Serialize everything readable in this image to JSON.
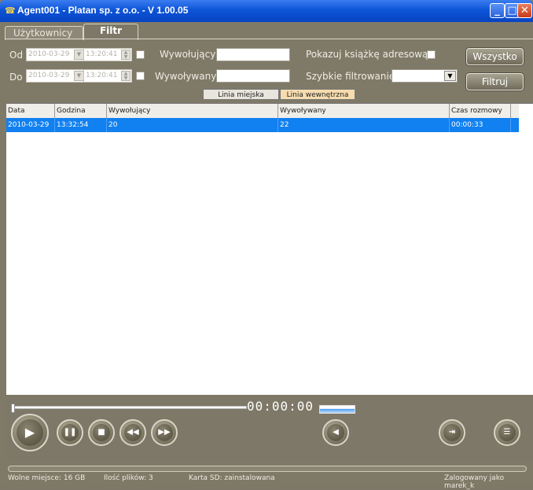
{
  "window": {
    "title": "Agent001 - Platan sp. z o.o. - V 1.00.05",
    "controls": {
      "minimize": "_",
      "maximize": "□",
      "close": "✕"
    }
  },
  "tabs": [
    {
      "label": "Użytkownicy",
      "active": false
    },
    {
      "label": "Filtr",
      "active": true
    }
  ],
  "filter": {
    "from_label": "Od",
    "to_label": "Do",
    "from_date": "2010-03-29",
    "from_time": "13:20:41",
    "to_date": "2010-03-29",
    "to_time": "13:20:41",
    "caller_label": "Wywołujący",
    "callee_label": "Wywoływany",
    "caller_value": "",
    "callee_value": "",
    "show_addressbook_label": "Pokazuj książkę adresową",
    "quick_filter_label": "Szybkie filtrowanie",
    "quick_filter_value": "",
    "all_button": "Wszystko",
    "filter_button": "Filtruj",
    "line_city": "Linia miejska",
    "line_internal": "Linia wewnętrzna"
  },
  "table": {
    "columns": [
      "Data",
      "Godzina",
      "Wywołujący",
      "Wywoływany",
      "Czas rozmowy"
    ],
    "rows": [
      [
        "2010-03-29",
        "13:32:54",
        "20",
        "22",
        "00:00:33"
      ]
    ]
  },
  "player": {
    "time": "00:00:00",
    "progress": 0.0,
    "volume": 1.0
  },
  "status": {
    "free_space": "Wolne miejsce: 16 GB",
    "file_count": "Ilość plików: 3",
    "sd_card": "Karta SD: zainstalowana",
    "logged_in": "Zalogowany jako marek_k"
  },
  "colors": {
    "titlebar": "#0d54d8",
    "window_bg": "#7d7867",
    "selection": "#1180f0"
  }
}
